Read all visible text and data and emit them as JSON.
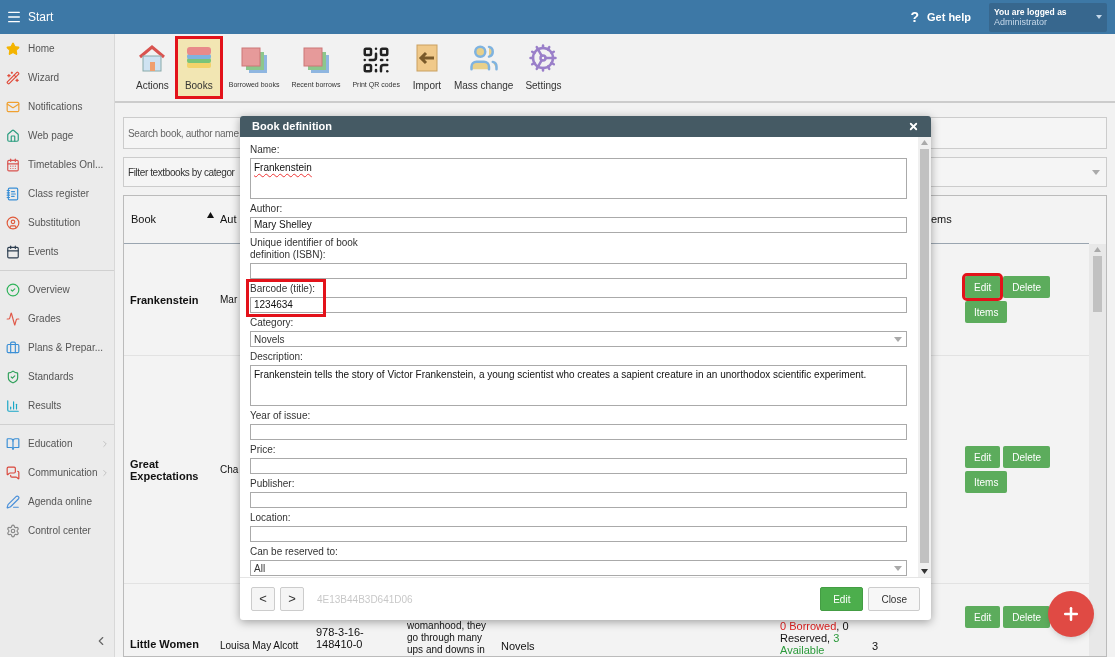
{
  "header": {
    "title": "Start",
    "help_glyph": "?",
    "help": "Get help",
    "user": {
      "caption": "You are logged as",
      "name": "Administrator"
    }
  },
  "sidebar": {
    "groups": [
      {
        "items": [
          {
            "label": "Home",
            "has_submenu": false
          },
          {
            "label": "Wizard",
            "has_submenu": false
          },
          {
            "label": "Notifications",
            "has_submenu": false
          },
          {
            "label": "Web page",
            "has_submenu": false
          },
          {
            "label": "Timetables Onl...",
            "has_submenu": false
          },
          {
            "label": "Class register",
            "has_submenu": false
          },
          {
            "label": "Substitution",
            "has_submenu": false
          },
          {
            "label": "Events",
            "has_submenu": false
          }
        ]
      },
      {
        "items": [
          {
            "label": "Overview",
            "has_submenu": false
          },
          {
            "label": "Grades",
            "has_submenu": false
          },
          {
            "label": "Plans & Prepar...",
            "has_submenu": false
          },
          {
            "label": "Standards",
            "has_submenu": false
          },
          {
            "label": "Results",
            "has_submenu": false
          }
        ]
      },
      {
        "items": [
          {
            "label": "Education",
            "has_submenu": true
          },
          {
            "label": "Communication",
            "has_submenu": true
          },
          {
            "label": "Agenda online",
            "has_submenu": false
          },
          {
            "label": "Control center",
            "has_submenu": false
          }
        ]
      }
    ]
  },
  "toolbar": [
    {
      "label": "Actions",
      "compact": false,
      "selected": false,
      "highlighted": false
    },
    {
      "label": "Books",
      "compact": false,
      "selected": true,
      "highlighted": true
    },
    {
      "label": "Borrowed books",
      "compact": true,
      "selected": false,
      "highlighted": false
    },
    {
      "label": "Recent borrows",
      "compact": true,
      "selected": false,
      "highlighted": false
    },
    {
      "label": "Print QR codes",
      "compact": true,
      "selected": false,
      "highlighted": false
    },
    {
      "label": "Import",
      "compact": false,
      "selected": false,
      "highlighted": false
    },
    {
      "label": "Mass change",
      "compact": false,
      "selected": false,
      "highlighted": false
    },
    {
      "label": "Settings",
      "compact": false,
      "selected": false,
      "highlighted": false
    }
  ],
  "search": {
    "placeholder": "Search book, author name"
  },
  "category_filter": {
    "placeholder": "Filter textbooks by categor"
  },
  "table": {
    "columns": [
      {
        "label": "Book",
        "sorted": true
      },
      {
        "label": "Aut"
      },
      {
        "label": "ems"
      }
    ],
    "rows": [
      {
        "book": "Frankenstein",
        "author": "Mar",
        "actions": [
          {
            "label": "Edit",
            "highlighted": true
          },
          {
            "label": "Delete",
            "highlighted": false
          },
          {
            "label": "Items",
            "highlighted": false
          }
        ]
      },
      {
        "book": "Great Expectations",
        "author": "Cha",
        "actions": [
          {
            "label": "Edit",
            "highlighted": false
          },
          {
            "label": "Delete",
            "highlighted": false
          },
          {
            "label": "Items",
            "highlighted": false
          }
        ]
      },
      {
        "book": "Little Women",
        "author": "Louisa May Alcott",
        "isbn": "978-3-16-148410-0",
        "description": "womanhood, they go through many ups and downs in",
        "category": "Novels",
        "status": [
          {
            "text": "0 Borrowed",
            "color": "#e02020"
          },
          {
            "text": ", 0 Reserved, ",
            "color": "#111111"
          },
          {
            "text": "3 Available",
            "color": "#2a9a3a"
          }
        ],
        "count": "3",
        "actions": [
          {
            "label": "Edit",
            "highlighted": false
          },
          {
            "label": "Delete",
            "highlighted": false
          }
        ]
      }
    ]
  },
  "modal": {
    "title": "Book definition",
    "fields": [
      {
        "label": "Name:",
        "kind": "textarea",
        "value": "Frankenstein",
        "spelling_error": true
      },
      {
        "label": "Author:",
        "kind": "text",
        "value": "Mary Shelley",
        "spelling_error": false
      },
      {
        "label": "Unique identifier of book definition (ISBN):",
        "kind": "text"
      },
      {
        "label": "Barcode (title):",
        "kind": "text",
        "value": "1234634",
        "spelling_error": false,
        "highlighted": true
      },
      {
        "label": "Category:",
        "kind": "select",
        "value": "Novels",
        "spelling_error": false
      },
      {
        "label": "Description:",
        "kind": "textarea",
        "value": "Frankenstein tells the story of Victor Frankenstein, a young scientist who creates a sapient creature in an unorthodox scientific experiment.",
        "spelling_error": false
      },
      {
        "label": "Year of issue:",
        "kind": "text"
      },
      {
        "label": "Price:",
        "kind": "text"
      },
      {
        "label": "Publisher:",
        "kind": "text"
      },
      {
        "label": "Location:",
        "kind": "text"
      },
      {
        "label": "Can be reserved to:",
        "kind": "select",
        "value": "All",
        "spelling_error": false
      }
    ],
    "nav": [
      "<",
      ">"
    ],
    "record_id": "4E13B44B3D641D06",
    "buttons": [
      {
        "label": "Edit",
        "kind": "primary"
      },
      {
        "label": "Close",
        "kind": "default"
      }
    ]
  }
}
